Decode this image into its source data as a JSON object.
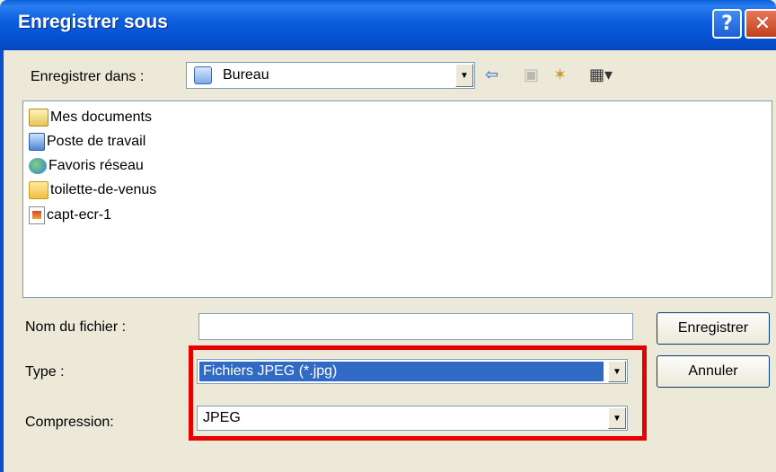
{
  "window": {
    "title": "Enregistrer sous",
    "help_glyph": "?",
    "close_glyph": "✕"
  },
  "toolbar": {
    "save_in_label": "Enregistrer dans :",
    "save_in_value": "Bureau",
    "back_icon": "back-arrow-icon",
    "up_icon": "up-folder-icon",
    "new_folder_icon": "new-folder-icon",
    "view_icon": "view-menu-icon"
  },
  "files": [
    {
      "name": "Mes documents",
      "icon": "my-documents-icon"
    },
    {
      "name": "Poste de travail",
      "icon": "my-computer-icon"
    },
    {
      "name": "Favoris réseau",
      "icon": "network-places-icon"
    },
    {
      "name": "toilette-de-venus",
      "icon": "folder-icon"
    },
    {
      "name": "capt-ecr-1",
      "icon": "image-file-icon"
    }
  ],
  "form": {
    "filename_label": "Nom du fichier :",
    "filename_value": "",
    "type_label": "Type :",
    "type_value": "Fichiers JPEG (*.jpg)",
    "compression_label": "Compression:",
    "compression_value": "JPEG"
  },
  "buttons": {
    "save": "Enregistrer",
    "cancel": "Annuler"
  },
  "colors": {
    "highlight_box": "#e60000",
    "selection": "#316ac5",
    "titlebar": "#0653d6"
  }
}
